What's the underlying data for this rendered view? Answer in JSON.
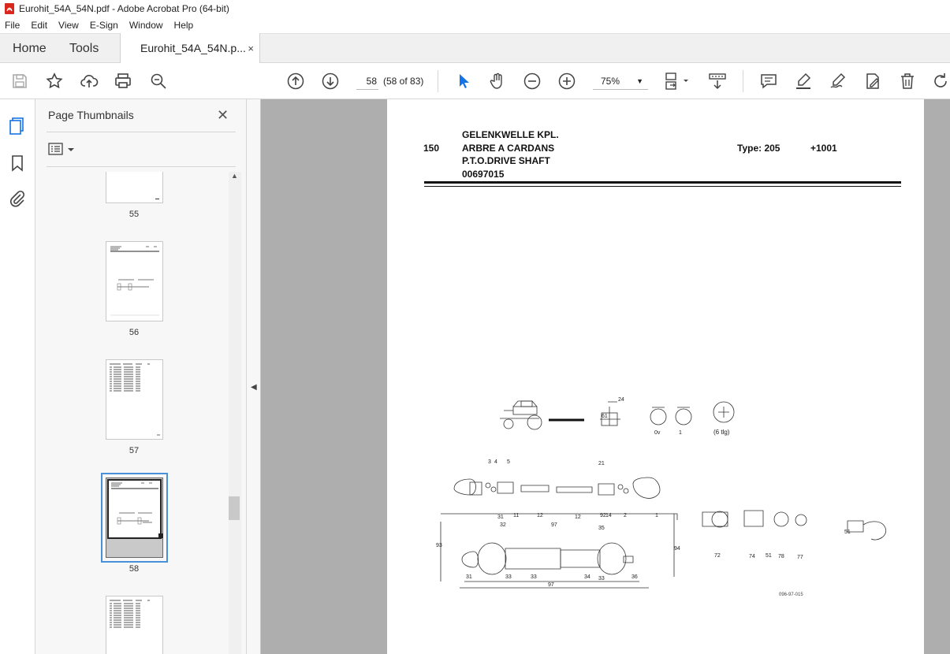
{
  "window": {
    "title": "Eurohit_54A_54N.pdf - Adobe Acrobat Pro (64-bit)"
  },
  "menu": [
    "File",
    "Edit",
    "View",
    "E-Sign",
    "Window",
    "Help"
  ],
  "tabs": {
    "home": "Home",
    "tools": "Tools",
    "document": "Eurohit_54A_54N.p...",
    "close": "×"
  },
  "toolbar": {
    "page_number": "58",
    "page_count": "(58 of 83)",
    "zoom": "75%",
    "icons": [
      "save-icon",
      "bookmark-star-icon",
      "upload-icon",
      "print-icon",
      "zoom-search-icon",
      "page-up-icon",
      "page-down-icon",
      "select-cursor-icon",
      "hand-icon",
      "zoom-out-icon",
      "zoom-in-icon",
      "page-display-icon",
      "scroll-mode-icon",
      "comment-icon",
      "highlight-icon",
      "sign-icon",
      "fill-sign-icon",
      "delete-icon",
      "rotate-icon"
    ]
  },
  "panel": {
    "title": "Page Thumbnails",
    "close": "✕",
    "thumbnails": [
      {
        "label": "55"
      },
      {
        "label": "56"
      },
      {
        "label": "57"
      },
      {
        "label": "58",
        "selected": true
      },
      {
        "label": ""
      }
    ]
  },
  "document": {
    "section": "150",
    "title_de": "GELENKWELLE KPL.",
    "title_fr": "ARBRE A CARDANS",
    "title_en": "P.T.O.DRIVE SHAFT",
    "part_no": "00697015",
    "type": "Type: 205",
    "serial": "+1001",
    "tlg": "(6 tlg)",
    "drawing_ref": "096-97-015",
    "labels": [
      "3",
      "4",
      "5",
      "21",
      "31",
      "11",
      "12",
      "12",
      "14",
      "2",
      "1",
      "93",
      "92",
      "32",
      "97",
      "35",
      "33",
      "34",
      "33",
      "36",
      "31",
      "94",
      "72",
      "74",
      "51",
      "78",
      "77",
      "51",
      "0v",
      "1",
      "24",
      "61"
    ]
  }
}
